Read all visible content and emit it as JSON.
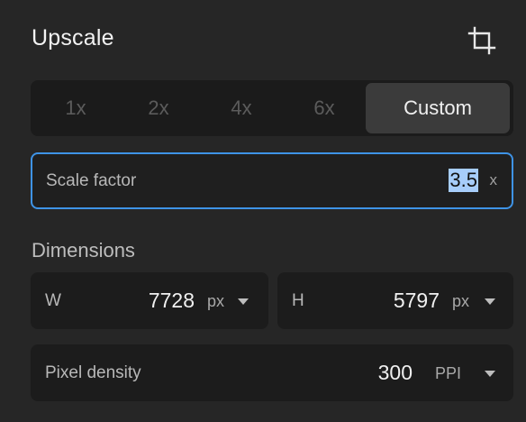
{
  "panel": {
    "title": "Upscale",
    "crop_icon": "crop-icon"
  },
  "scale_options": [
    {
      "label": "1x",
      "active": false
    },
    {
      "label": "2x",
      "active": false
    },
    {
      "label": "4x",
      "active": false
    },
    {
      "label": "6x",
      "active": false
    },
    {
      "label": "Custom",
      "active": true
    }
  ],
  "scale_factor": {
    "label": "Scale factor",
    "value": "3.5",
    "unit": "x"
  },
  "dimensions": {
    "label": "Dimensions",
    "width": {
      "label": "W",
      "value": "7728",
      "unit": "px"
    },
    "height": {
      "label": "H",
      "value": "5797",
      "unit": "px"
    }
  },
  "pixel_density": {
    "label": "Pixel density",
    "value": "300",
    "unit": "PPI"
  },
  "colors": {
    "background": "#262626",
    "focus_border": "#3e93e6",
    "selection": "#a7cdfa"
  }
}
